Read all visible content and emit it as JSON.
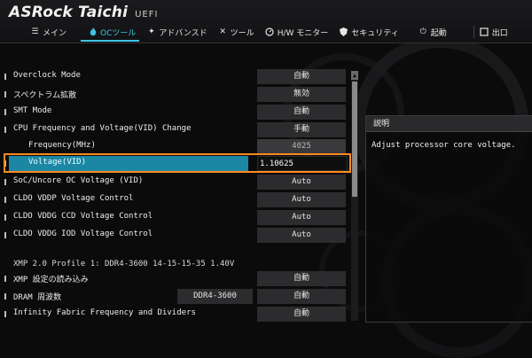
{
  "header": {
    "brand": "ASRock Taichi",
    "firmware": "UEFI",
    "tabs": [
      {
        "icon": "list-icon",
        "label": "メイン"
      },
      {
        "icon": "flame-icon",
        "label": "OCツール"
      },
      {
        "icon": "star-icon",
        "label": "アドバンスド"
      },
      {
        "icon": "wrench-icon",
        "label": "ツール"
      },
      {
        "icon": "monitor-icon",
        "label": "H/W モニター"
      },
      {
        "icon": "shield-icon",
        "label": "セキュリティ"
      },
      {
        "icon": "power-icon",
        "label": "起動"
      },
      {
        "icon": "exit-icon",
        "label": "出口"
      }
    ],
    "active_tab": "OCツール"
  },
  "settings": [
    {
      "label": "Overclock Mode",
      "value": "自動"
    },
    {
      "label": "スペクトラム拡散",
      "value": "無効"
    },
    {
      "label": "SMT Mode",
      "value": "自動"
    },
    {
      "label": "CPU Frequency and Voltage(VID) Change",
      "value": "手動"
    },
    {
      "label": "Frequency(MHz)",
      "value": "4025"
    },
    {
      "label": "Voltage(VID)",
      "value": "1.10625"
    },
    {
      "label": "SoC/Uncore OC Voltage (VID)",
      "value": "Auto"
    },
    {
      "label": "CLDO VDDP Voltage Control",
      "value": "Auto"
    },
    {
      "label": "CLDO VDDG CCD Voltage Control",
      "value": "Auto"
    },
    {
      "label": "CLDO VDDG IOD Voltage Control",
      "value": "Auto"
    }
  ],
  "xmp_info": "XMP 2.0 Profile 1: DDR4-3600 14-15-15-35 1.40V",
  "settings2": [
    {
      "label": "XMP 設定の読み込み",
      "value": "自動"
    },
    {
      "label": "DRAM 周波数",
      "value": "自動",
      "extra": "DDR4-3600"
    },
    {
      "label": "Infinity Fabric Frequency and Dividers",
      "value": "自動"
    }
  ],
  "description": {
    "title": "説明",
    "text": "Adjust processor core voltage."
  },
  "colors": {
    "accent": "#3fc3e6",
    "selection": "#1b87a5",
    "highlight_frame": "#ff8a1f"
  }
}
